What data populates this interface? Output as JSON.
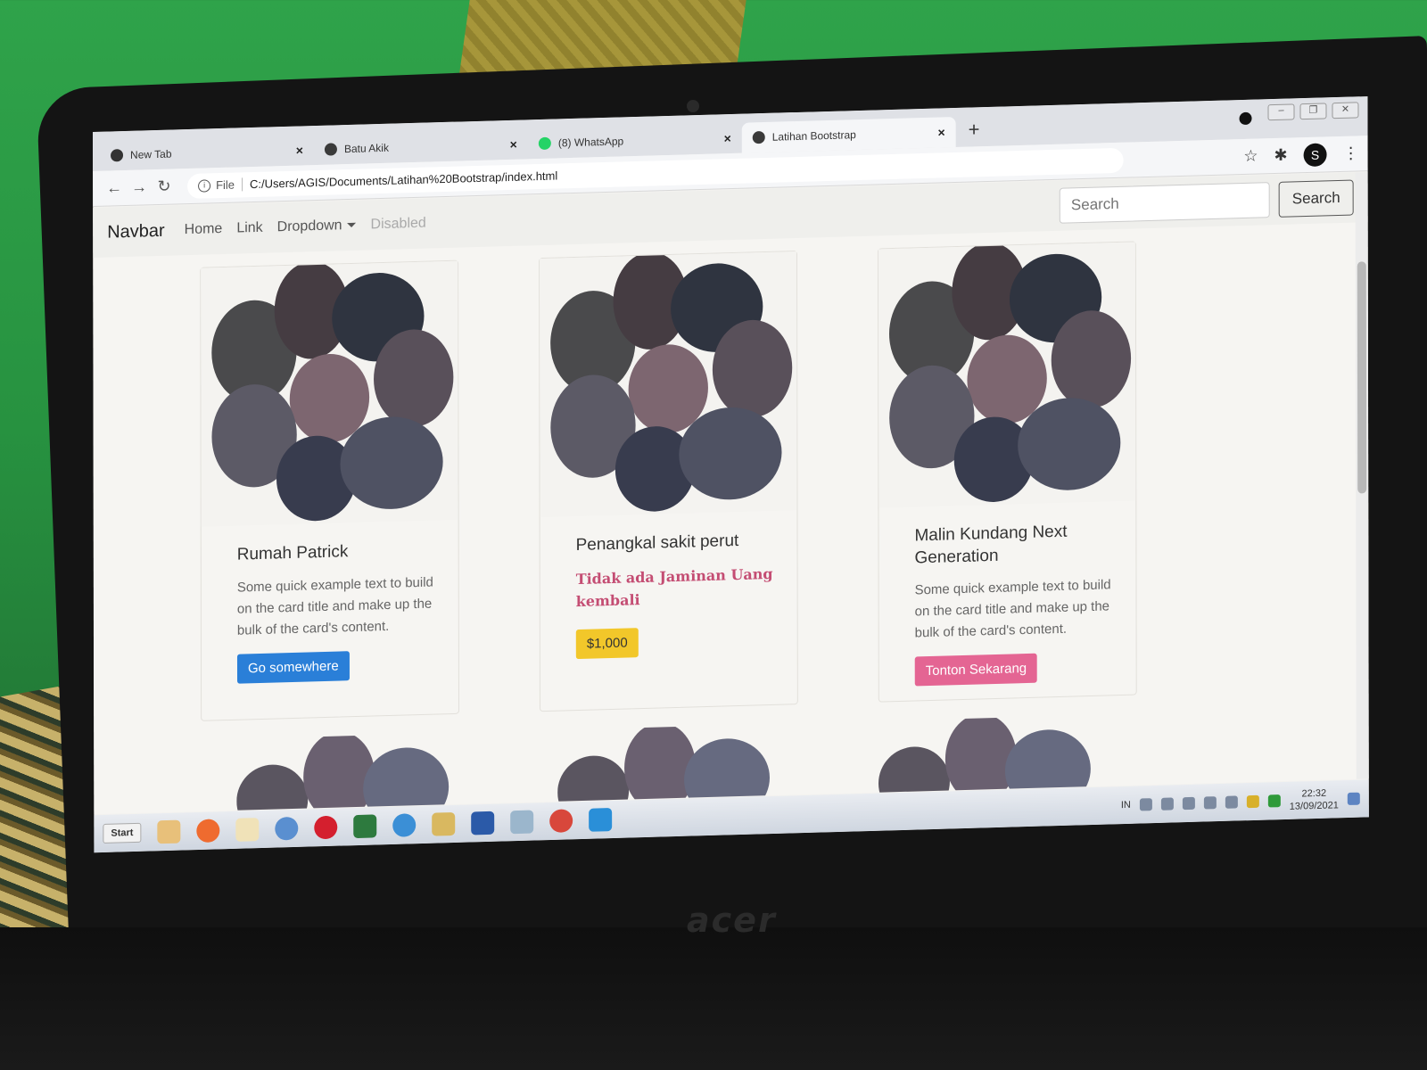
{
  "browser": {
    "tabs": [
      {
        "label": "New Tab",
        "fav_color": "#333333"
      },
      {
        "label": "Batu Akik",
        "fav_color": "#3a3a3a"
      },
      {
        "label": "(8) WhatsApp",
        "fav_color": "#25d366"
      },
      {
        "label": "Latihan Bootstrap",
        "fav_color": "#3a3a3a"
      }
    ],
    "new_tab_glyph": "+",
    "close_glyph": "×",
    "address": {
      "scheme": "File",
      "url": "C:/Users/AGIS/Documents/Latihan%20Bootstrap/index.html"
    },
    "profile_initial": "S"
  },
  "navbar": {
    "brand": "Navbar",
    "links": [
      "Home",
      "Link",
      "Dropdown",
      "Disabled"
    ],
    "search_placeholder": "Search",
    "search_button": "Search"
  },
  "cards": [
    {
      "title": "Rumah Patrick",
      "text": "Some quick example text to build on the card title and make up the bulk of the card's content.",
      "button": "Go somewhere"
    },
    {
      "title": "Penangkal sakit perut",
      "subtitle": "Tidak ada Jaminan Uang kembali",
      "button": "$1,000"
    },
    {
      "title": "Malin Kundang Next Generation",
      "text": "Some quick example text to build on the card title and make up the bulk of the card's content.",
      "button": "Tonton Sekarang"
    }
  ],
  "taskbar": {
    "start": "Start",
    "language": "IN",
    "time": "22:32",
    "date": "13/09/2021"
  },
  "device": {
    "brand": "acer"
  }
}
